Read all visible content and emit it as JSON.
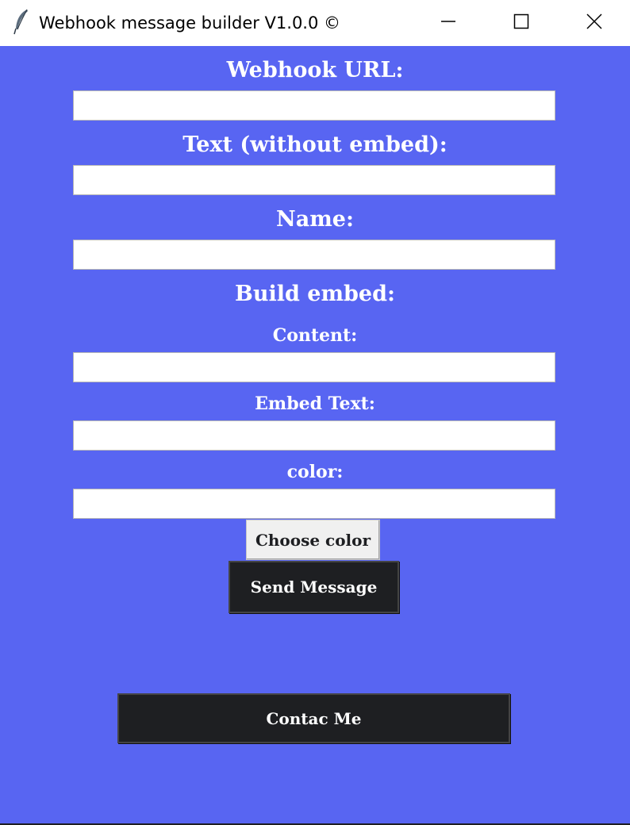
{
  "window": {
    "title": "Webhook message builder V1.0.0 ©",
    "icon": "feather-icon",
    "controls": [
      "minimize-icon",
      "maximize-icon",
      "close-icon"
    ]
  },
  "form": {
    "webhook_url_label": "Webhook URL:",
    "webhook_url_value": "",
    "text_label": "Text (without embed):",
    "text_value": "",
    "name_label": "Name:",
    "name_value": "",
    "build_embed_label": "Build embed:",
    "content_label": "Content:",
    "content_value": "",
    "embed_text_label": "Embed Text:",
    "embed_text_value": "",
    "color_label": "color:",
    "color_value": ""
  },
  "buttons": {
    "choose_color": "Choose color",
    "send_message": "Send Message",
    "contact_me": "Contac Me"
  },
  "colors": {
    "background": "#5865f2",
    "dark_button": "#1e1f22",
    "text": "#ffffff"
  }
}
